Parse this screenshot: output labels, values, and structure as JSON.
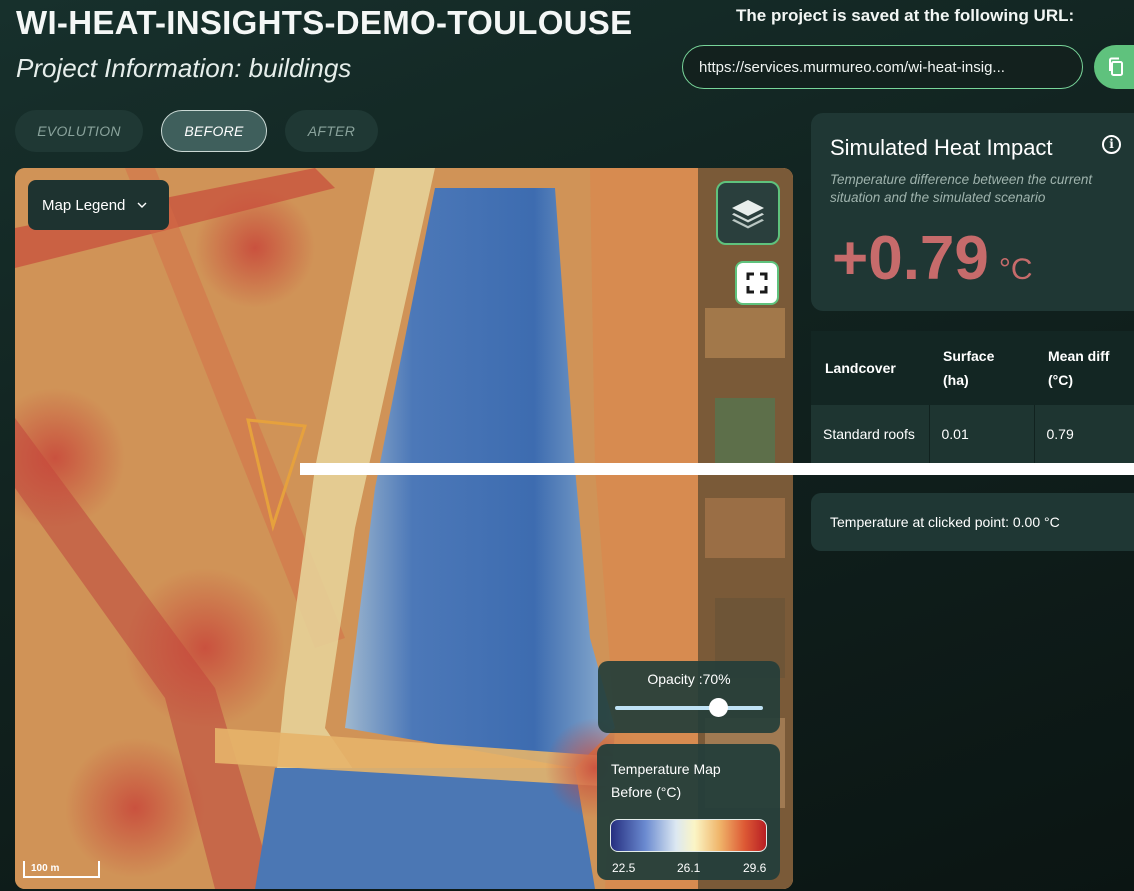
{
  "header": {
    "title": "WI-HEAT-INSIGHTS-DEMO-TOULOUSE",
    "subtitle": "Project Information: buildings",
    "url_caption": "The project is saved at the following URL:",
    "url_value": "https://services.murmureo.com/wi-heat-insig..."
  },
  "tabs": [
    {
      "label": "EVOLUTION",
      "active": false
    },
    {
      "label": "BEFORE",
      "active": true
    },
    {
      "label": "AFTER",
      "active": false
    }
  ],
  "map": {
    "legend_button": "Map Legend",
    "opacity_label": "Opacity :70%",
    "opacity_value": 0.7,
    "temperature_legend": {
      "title_line1": "Temperature Map",
      "title_line2": "Before (°C)",
      "ticks": [
        "22.5",
        "26.1",
        "29.6"
      ]
    },
    "scale_label": "100 m"
  },
  "impact": {
    "title": "Simulated Heat Impact",
    "description": "Temperature difference between the current situation and the simulated scenario",
    "value": "+0.79",
    "unit": "°C"
  },
  "landcover_table": {
    "headers": [
      "Landcover",
      "Surface (ha)",
      "Mean diff (°C)"
    ],
    "rows": [
      [
        "Standard roofs",
        "0.01",
        "0.79"
      ]
    ]
  },
  "clicked_point": "Temperature at clicked point: 0.00 °C",
  "colors": {
    "accent": "#5fc27d",
    "impact_value": "#c66b6b",
    "background": "#11221f"
  }
}
